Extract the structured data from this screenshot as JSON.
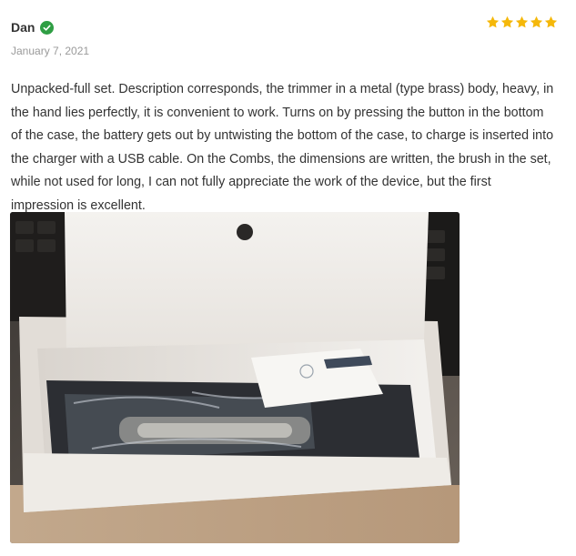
{
  "review": {
    "author": "Dan",
    "date": "January 7, 2021",
    "rating": 5,
    "text": "Unpacked-full set. Description corresponds, the trimmer in a metal (type brass) body, heavy, in the hand lies perfectly, it is convenient to work. Turns on by pressing the button in the bottom of the case, the battery gets out by untwisting the bottom of the case, to charge is inserted into the charger with a USB cable. On the Combs, the dimensions are written, the brush in the set, while not used for long, I can not fully appreciate the work of the device, but the first impression is excellent."
  },
  "icons": {
    "verified": "check-circle-icon",
    "rating": "star-icon"
  },
  "colors": {
    "star": "#f5b80a",
    "verified": "#2f9e44",
    "author": "#333333",
    "date": "#9a9a9a",
    "text": "#333333"
  }
}
